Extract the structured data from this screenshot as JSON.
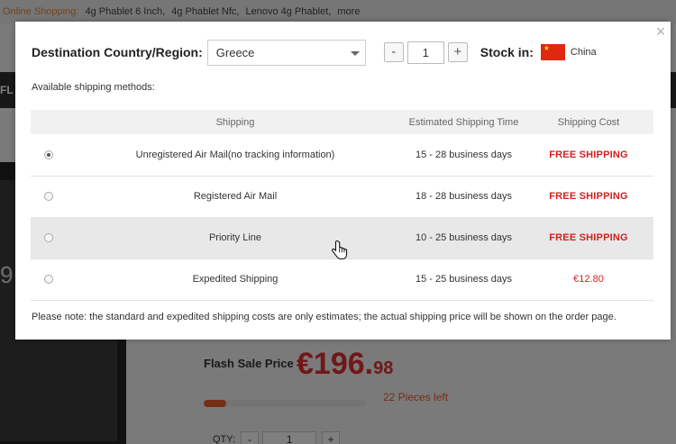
{
  "background": {
    "topbar": {
      "label": "Online Shopping:",
      "links": [
        "4g Phablet 6 Inch,",
        "4g Phablet Nfc,",
        "Lenovo 4g Phablet,",
        "more"
      ]
    },
    "nav_fragment": "FL",
    "phone_fragment": "9",
    "flash_sale_label": "Flash Sale Price",
    "flash_price_main": "€196.",
    "flash_price_decimal": "98",
    "stock_fraction": 0.14,
    "pieces_left": "22 Pieces left",
    "qty_label": "QTY:",
    "qty_minus": "-",
    "qty_value": "1",
    "qty_plus": "+"
  },
  "modal": {
    "close_glyph": "×",
    "destination_label": "Destination Country/Region:",
    "destination_value": "Greece",
    "quantity": {
      "minus": "-",
      "value": "1",
      "plus": "+"
    },
    "stock_label": "Stock in:",
    "stock_country": "China",
    "available_label": "Available shipping methods:",
    "table": {
      "headers": [
        "Shipping",
        "Estimated Shipping Time",
        "Shipping Cost"
      ],
      "rows": [
        {
          "method": "Unregistered Air Mail(no tracking information)",
          "time": "15 - 28 business days",
          "cost": "FREE SHIPPING",
          "selected": true
        },
        {
          "method": "Registered Air Mail",
          "time": "18 - 28 business days",
          "cost": "FREE SHIPPING",
          "selected": false
        },
        {
          "method": "Priority Line",
          "time": "10 - 25 business days",
          "cost": "FREE SHIPPING",
          "selected": false
        },
        {
          "method": "Expedited Shipping",
          "time": "15 - 25 business days",
          "cost": "€12.80",
          "selected": false
        }
      ]
    },
    "note": "Please note: the standard and expedited shipping costs are only estimates; the actual shipping price will be shown on the order page."
  },
  "colors": {
    "accent_red": "#d42020",
    "flag_red": "#de2910",
    "flag_yellow": "#ffde00"
  },
  "icons": {
    "close": "close-icon",
    "caret": "chevron-down-icon",
    "cursor": "hand-pointer-icon",
    "flag": "china-flag-icon"
  }
}
